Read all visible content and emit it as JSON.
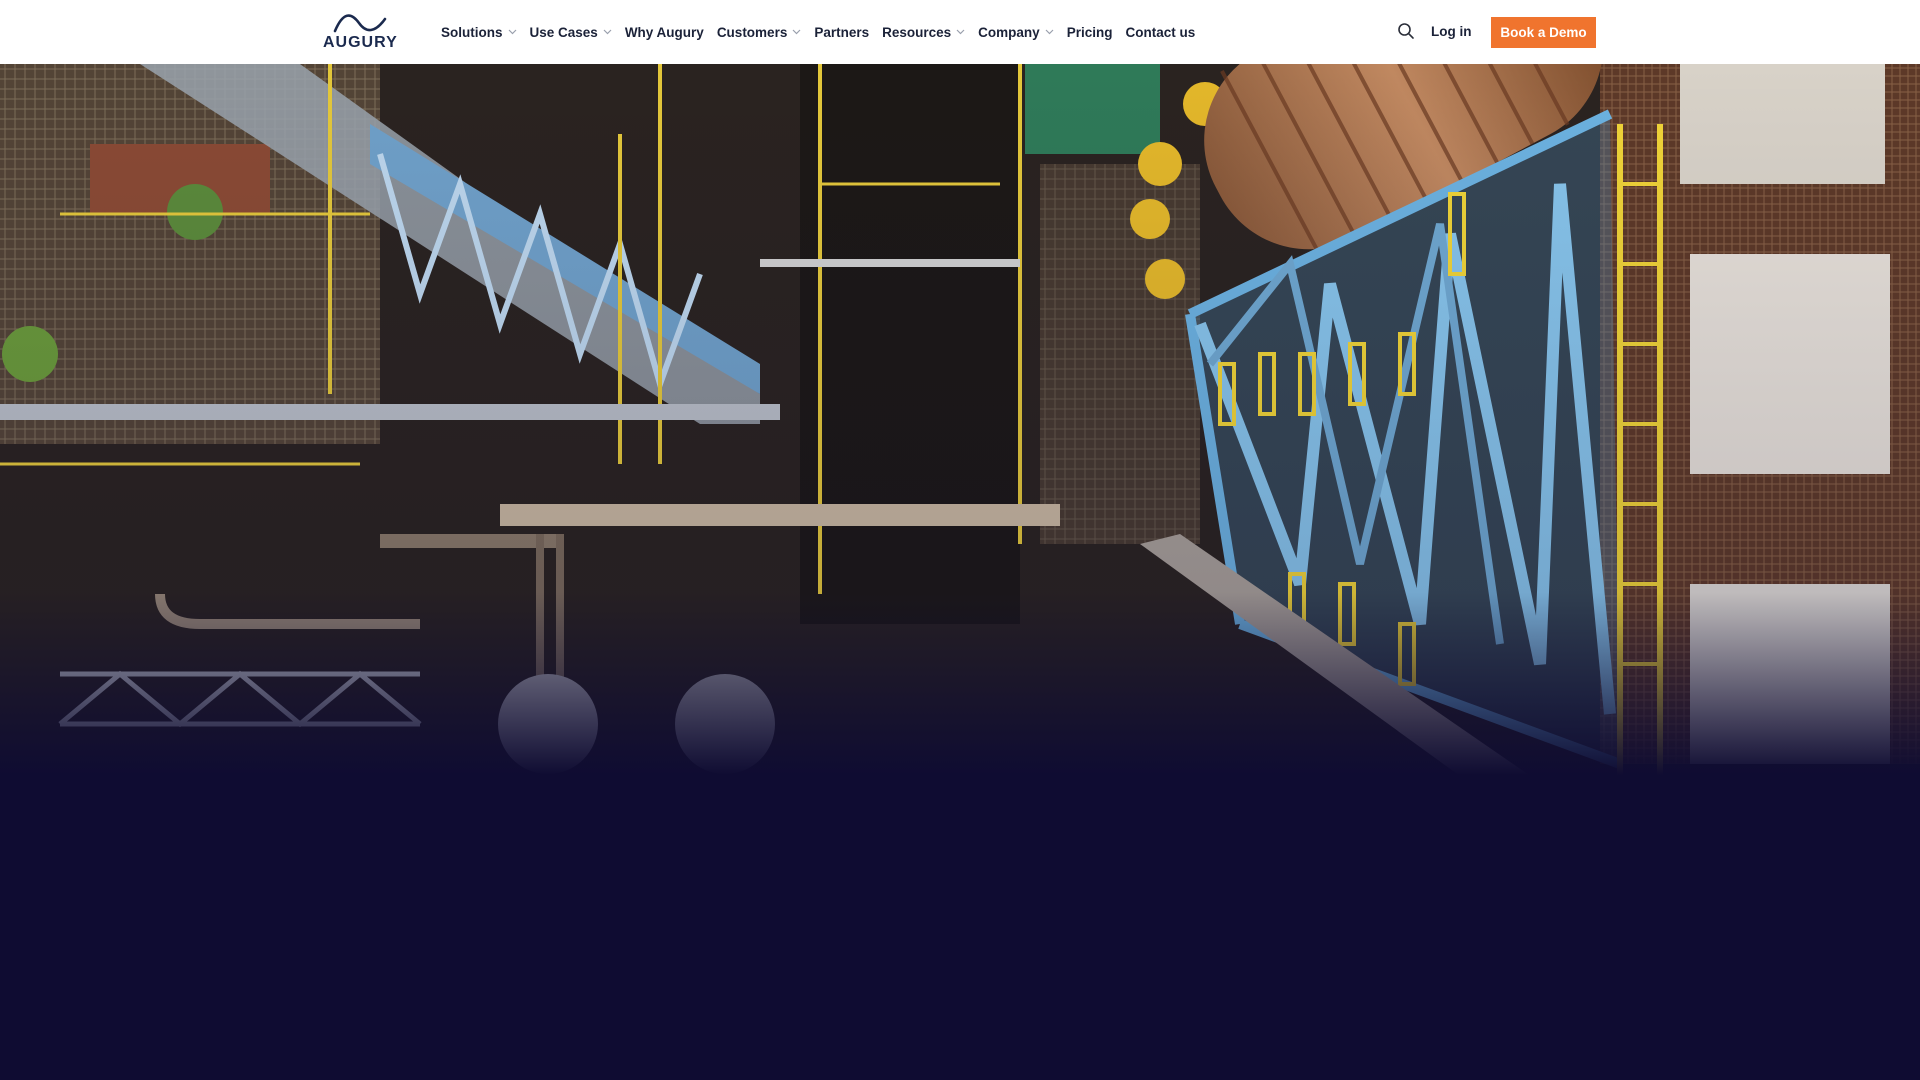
{
  "brand": {
    "name": "AUGURY",
    "colors": {
      "navy": "#1b2a4e",
      "accent": "#f0742e",
      "hero_bg": "#0f0c32"
    }
  },
  "nav": {
    "items": [
      {
        "label": "Solutions",
        "dropdown": true
      },
      {
        "label": "Use Cases",
        "dropdown": true
      },
      {
        "label": "Why Augury",
        "dropdown": false
      },
      {
        "label": "Customers",
        "dropdown": true
      },
      {
        "label": "Partners",
        "dropdown": false
      },
      {
        "label": "Resources",
        "dropdown": true
      },
      {
        "label": "Company",
        "dropdown": true
      },
      {
        "label": "Pricing",
        "dropdown": false
      },
      {
        "label": "Contact us",
        "dropdown": false
      }
    ]
  },
  "header_actions": {
    "search_icon": "search-icon",
    "login_label": "Log in",
    "demo_label": "Book a Demo"
  },
  "hero": {
    "image": "aerial-industrial-plant",
    "overlay_color": "#0f0c32"
  }
}
